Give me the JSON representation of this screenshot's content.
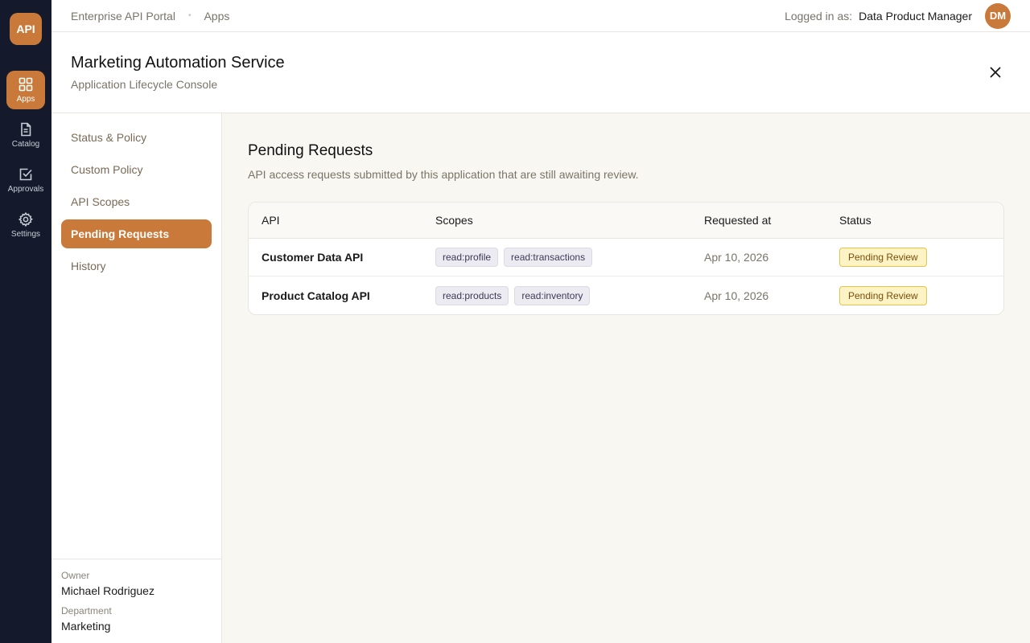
{
  "rail": {
    "logo": "API",
    "items": [
      {
        "label": "Apps",
        "icon": "grid-icon",
        "active": true
      },
      {
        "label": "Catalog",
        "icon": "document-icon",
        "active": false
      },
      {
        "label": "Approvals",
        "icon": "checkbox-icon",
        "active": false
      },
      {
        "label": "Settings",
        "icon": "gear-icon",
        "active": false
      }
    ]
  },
  "topbar": {
    "breadcrumb": [
      "Enterprise API Portal",
      "Apps"
    ],
    "separator": "•",
    "logged_label": "Logged in as:",
    "user_name": "Data Product Manager",
    "avatar_initials": "DM"
  },
  "header": {
    "title": "Marketing Automation Service",
    "subtitle": "Application Lifecycle Console",
    "close_icon": "close-icon"
  },
  "sidenav": {
    "items": [
      {
        "label": "Status & Policy",
        "active": false
      },
      {
        "label": "Custom Policy",
        "active": false
      },
      {
        "label": "API Scopes",
        "active": false
      },
      {
        "label": "Pending Requests",
        "active": true
      },
      {
        "label": "History",
        "active": false
      }
    ],
    "owner_label": "Owner",
    "owner_value": "Michael Rodriguez",
    "department_label": "Department",
    "department_value": "Marketing"
  },
  "main": {
    "title": "Pending Requests",
    "description": "API access requests submitted by this application that are still awaiting review.",
    "table": {
      "headers": {
        "api": "API",
        "scopes": "Scopes",
        "requested": "Requested at",
        "status": "Status"
      },
      "rows": [
        {
          "api": "Customer Data API",
          "scopes": [
            "read:profile",
            "read:transactions"
          ],
          "requested": "Apr 10, 2026",
          "status": "Pending Review"
        },
        {
          "api": "Product Catalog API",
          "scopes": [
            "read:products",
            "read:inventory"
          ],
          "requested": "Apr 10, 2026",
          "status": "Pending Review"
        }
      ]
    }
  },
  "colors": {
    "accent": "#c97a3a",
    "rail_bg": "#141a2b",
    "content_bg": "#f9f7f2",
    "badge_bg": "#fdf3c4"
  }
}
